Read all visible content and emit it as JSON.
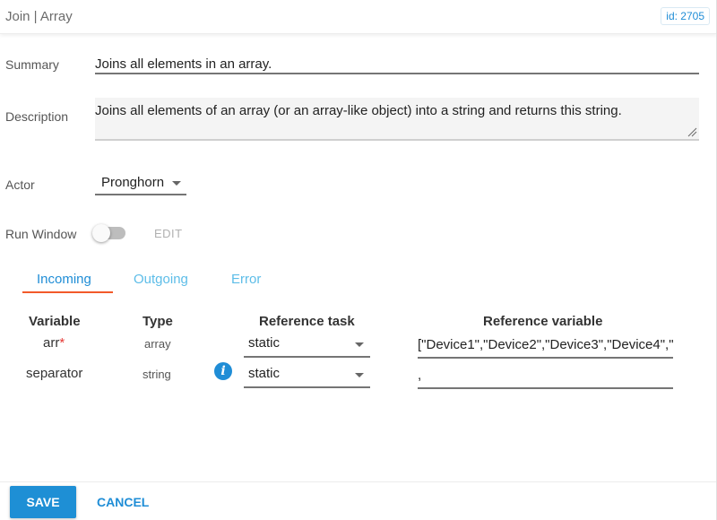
{
  "header": {
    "title": "Join | Array",
    "id_badge": "id: 2705"
  },
  "form": {
    "summary_label": "Summary",
    "summary_value": "Joins all elements in an array.",
    "description_label": "Description",
    "description_value": "Joins all elements of an array (or an array-like object) into a string and returns this string.",
    "actor_label": "Actor",
    "actor_value": "Pronghorn",
    "run_window_label": "Run Window",
    "run_window_enabled": false,
    "edit_label": "EDIT"
  },
  "tabs": [
    {
      "label": "Incoming",
      "active": true
    },
    {
      "label": "Outgoing",
      "active": false
    },
    {
      "label": "Error",
      "active": false
    }
  ],
  "table": {
    "headers": {
      "variable": "Variable",
      "type": "Type",
      "reference_task": "Reference task",
      "reference_variable": "Reference variable"
    },
    "rows": [
      {
        "variable": "arr",
        "required_mark": "*",
        "type": "array",
        "reference_task": "static",
        "reference_variable": "[\"Device1\",\"Device2\",\"Device3\",\"Device4\",\""
      },
      {
        "variable": "separator",
        "type": "string",
        "reference_task": "static",
        "reference_variable": ","
      }
    ]
  },
  "footer": {
    "save_label": "SAVE",
    "cancel_label": "CANCEL"
  },
  "colors": {
    "accent": "#1f8dd6",
    "tab_underline": "#f25a2a",
    "required": "#e53935"
  },
  "icons": {
    "info": "info-icon",
    "dropdown": "caret-down-icon"
  }
}
